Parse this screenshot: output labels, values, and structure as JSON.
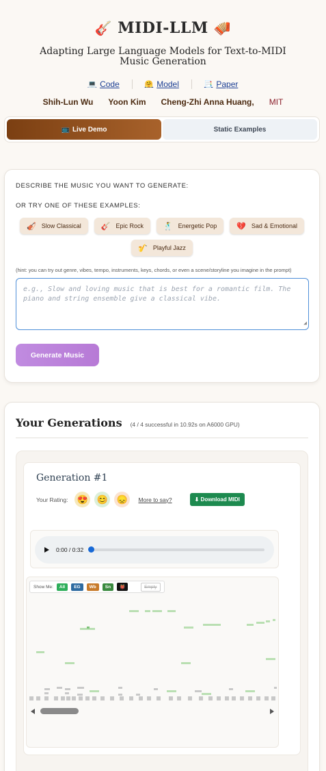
{
  "header": {
    "title": "MIDI-LLM",
    "subtitle": "Adapting Large Language Models for Text-to-MIDI Music Generation",
    "links": [
      {
        "label": "Code",
        "icon": "💻"
      },
      {
        "label": "Model",
        "icon": "🤗"
      },
      {
        "label": "Paper",
        "icon": "📑"
      }
    ],
    "authors": [
      "Shih-Lun Wu",
      "Yoon Kim",
      "Cheng-Zhi Anna Huang,"
    ],
    "institution": "MIT"
  },
  "tabs": {
    "live_demo": "Live Demo",
    "static_examples": "Static Examples"
  },
  "form": {
    "describe_label": "DESCRIBE THE MUSIC YOU WANT TO GENERATE:",
    "examples_label": "OR TRY ONE OF THESE EXAMPLES:",
    "examples": [
      {
        "label": "Slow Classical",
        "icon": "🎻"
      },
      {
        "label": "Epic Rock",
        "icon": "🎸"
      },
      {
        "label": "Energetic Pop",
        "icon": "🕺"
      },
      {
        "label": "Sad & Emotional",
        "icon": "💔"
      },
      {
        "label": "Playful Jazz",
        "icon": "🎷"
      }
    ],
    "hint": "(hint: you can try out genre, vibes, tempo, instruments, keys, chords, or even a scene/storyline you imagine in the prompt)",
    "placeholder": "e.g., Slow and loving music that is best for a romantic film. The piano and string ensemble give a classical vibe.",
    "generate_label": "Generate Music"
  },
  "generations": {
    "title": "Your Generations",
    "summary": "(4 / 4 successful in 10.92s on A6000 GPU)",
    "items": [
      {
        "name": "Generation #1",
        "rating_label": "Your Rating:",
        "more_label": "More to say?",
        "download_label": "⬇ Download MIDI",
        "time": "0:00 / 0:32",
        "progress": 0,
        "show_me_label": "Show Me:",
        "toggles": [
          {
            "label": "All",
            "color": "#2fae5b"
          },
          {
            "label": "EG",
            "color": "#2d6aa0"
          },
          {
            "label": "Wb",
            "color": "#c77a2a"
          },
          {
            "label": "Sn",
            "color": "#3a8a3f"
          },
          {
            "label": "👹",
            "color": "#111111"
          }
        ],
        "empty_label": "Empty"
      }
    ]
  },
  "colors": {
    "accent": "#8b4a1a",
    "generate": "#b77ad6",
    "download": "#1d8a4f",
    "note_green": "#b9dfb2",
    "note_gray": "#c8c8c8"
  }
}
